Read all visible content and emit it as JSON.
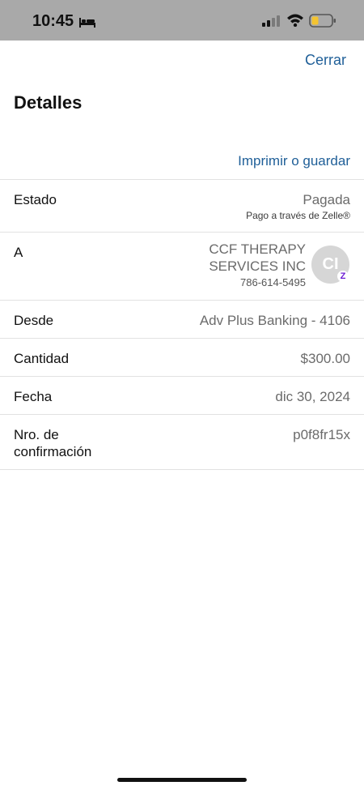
{
  "status_bar": {
    "time": "10:45",
    "icons": [
      "bed-icon",
      "signal-icon",
      "wifi-icon",
      "battery-icon"
    ],
    "battery_color": "#f4c430"
  },
  "header": {
    "close_label": "Cerrar",
    "title": "Detalles",
    "print_label": "Imprimir o guardar"
  },
  "details": {
    "status": {
      "label": "Estado",
      "value": "Pagada",
      "sub": "Pago a través de Zelle®"
    },
    "recipient": {
      "label": "A",
      "name": "CCF THERAPY SERVICES INC",
      "phone": "786-614-5495",
      "initials": "CI",
      "badge": "Z"
    },
    "from": {
      "label": "Desde",
      "value": "Adv Plus Banking - 4106"
    },
    "amount": {
      "label": "Cantidad",
      "value": "$300.00"
    },
    "date": {
      "label": "Fecha",
      "value": "dic 30, 2024"
    },
    "confirmation": {
      "label": "Nro. de confirmación",
      "value": "p0f8fr15x"
    }
  },
  "colors": {
    "link": "#1f5f98",
    "status_bar_bg": "#a9a9a9",
    "zelle_purple": "#6d1ed4"
  }
}
